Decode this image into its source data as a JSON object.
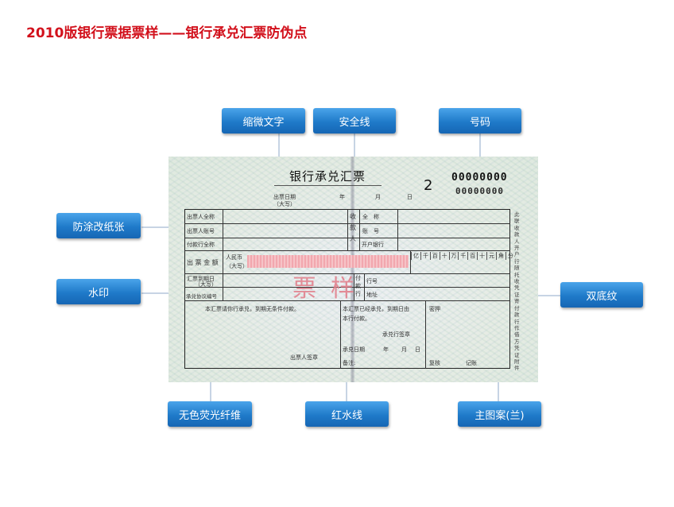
{
  "title": "2010版银行票据票样——银行承兑汇票防伪点",
  "callouts": {
    "micro_text": "缩微文字",
    "security_thread": "安全线",
    "serial_number": "号码",
    "anti_alteration_paper": "防涂改纸张",
    "watermark": "水印",
    "dual_background": "双底纹",
    "colorless_fluorescent_fiber": "无色荧光纤维",
    "red_water_line": "红水线",
    "main_pattern": "主图案(兰)"
  },
  "bill": {
    "title": "银行承兑汇票",
    "number": "2",
    "serial_top": "00000000",
    "serial_bottom": "00000000",
    "issue_date_label": "出票日期",
    "issue_date_sub": "（大写）",
    "year": "年",
    "month": "月",
    "day": "日",
    "drawer_full_name": "出票人全称",
    "drawer_account": "出票人账号",
    "paying_bank_name": "付款行全称",
    "payee_vertical": "收款人",
    "full_name": "全　称",
    "account_no": "账　号",
    "opening_bank": "开户银行",
    "amount_label": "出 票 金 额",
    "currency": "人民币",
    "currency_sub": "（大写）",
    "digit_units": [
      "亿",
      "千",
      "百",
      "十",
      "万",
      "千",
      "百",
      "十",
      "元",
      "角",
      "分"
    ],
    "due_date_label": "汇票到期日",
    "due_date_sub": "（大写）",
    "acceptance_no_label": "承兑协议编号",
    "payer_bank_vertical": "付款行",
    "bank_no": "行号",
    "address": "地址",
    "stamp_text": "票样",
    "note_left": "本汇票请你行承兑，到期无条件付款。",
    "note_mid_1": "本汇票已经承兑，到期日由",
    "note_mid_2": "本行付款。",
    "acceptor_seal": "承兑行签章",
    "acceptance_date": "承兑日期",
    "remarks": "备注:",
    "drawer_seal": "出票人签章",
    "secret_code": "密押",
    "review": "复核",
    "record": "记账",
    "side_text": "此联收款人开户行随托收凭证寄付款行作借方凭证附件"
  }
}
